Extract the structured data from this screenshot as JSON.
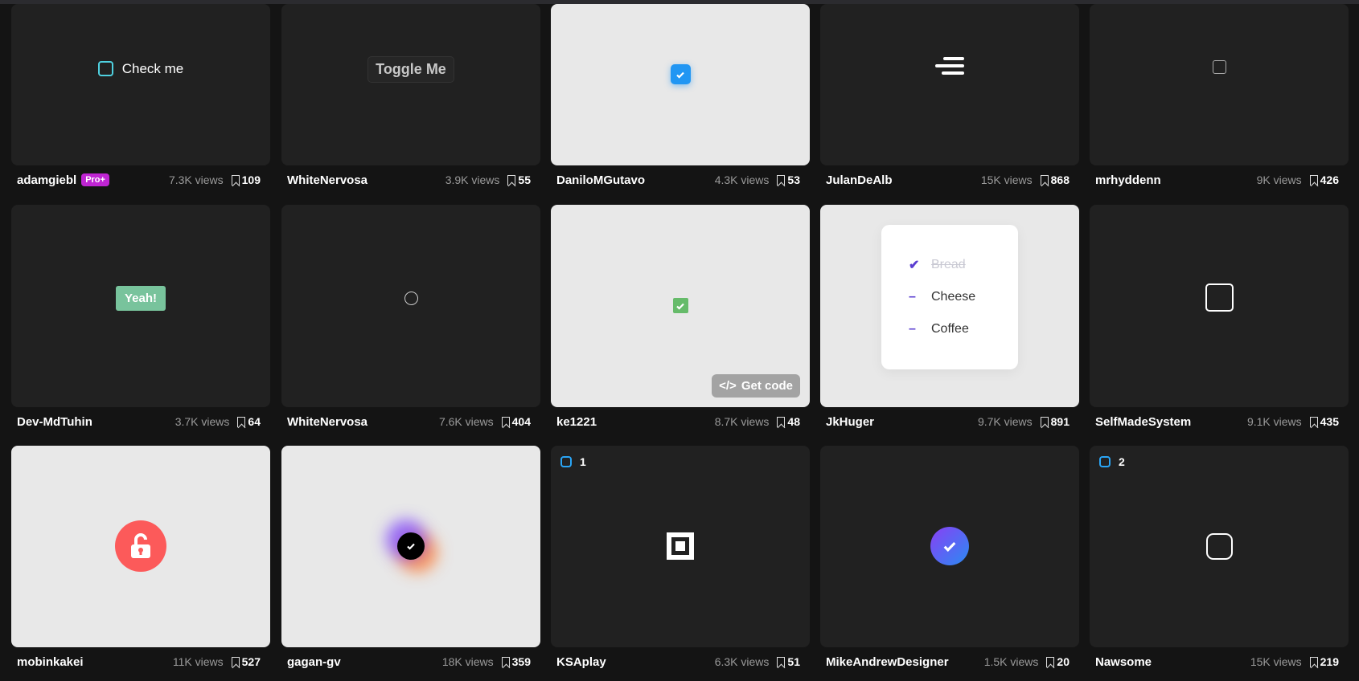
{
  "colors": {
    "accent_blue": "#2196f3",
    "pro_badge": "#c025d3"
  },
  "cards": [
    {
      "author": "adamgiebl",
      "pro": "Pro+",
      "views": "7.3K views",
      "saves": "109",
      "preview": "check",
      "text": "Check me"
    },
    {
      "author": "WhiteNervosa",
      "views": "3.9K views",
      "saves": "55",
      "preview": "toggle",
      "text": "Toggle Me"
    },
    {
      "author": "DaniloMGutavo",
      "views": "4.3K views",
      "saves": "53",
      "preview": "bluecheck",
      "light": true
    },
    {
      "author": "JulanDeAlb",
      "views": "15K views",
      "saves": "868",
      "preview": "lines"
    },
    {
      "author": "mrhyddenn",
      "views": "9K views",
      "saves": "426",
      "preview": "smallsquare"
    },
    {
      "author": "Dev-MdTuhin",
      "views": "3.7K views",
      "saves": "64",
      "preview": "yeah",
      "text": "Yeah!"
    },
    {
      "author": "WhiteNervosa",
      "views": "7.6K views",
      "saves": "404",
      "preview": "circle"
    },
    {
      "author": "ke1221",
      "views": "8.7K views",
      "saves": "48",
      "preview": "greencheck",
      "light": true,
      "text": "Get code"
    },
    {
      "author": "JkHuger",
      "views": "9.7K views",
      "saves": "891",
      "preview": "list",
      "light": true,
      "items": [
        "Bread",
        "Cheese",
        "Coffee"
      ]
    },
    {
      "author": "SelfMadeSystem",
      "views": "9.1K views",
      "saves": "435",
      "preview": "bigsquare"
    },
    {
      "author": "mobinkakei",
      "views": "11K views",
      "saves": "527",
      "preview": "lock",
      "light": true
    },
    {
      "author": "gagan-gv",
      "views": "18K views",
      "saves": "359",
      "preview": "glow",
      "light": true
    },
    {
      "author": "KSAplay",
      "views": "6.3K views",
      "saves": "51",
      "preview": "boxsquare",
      "badge": "1"
    },
    {
      "author": "MikeAndrewDesigner",
      "views": "1.5K views",
      "saves": "20",
      "preview": "gradcheck"
    },
    {
      "author": "Nawsome",
      "views": "15K views",
      "saves": "219",
      "preview": "roundsquare",
      "badge": "2"
    }
  ]
}
